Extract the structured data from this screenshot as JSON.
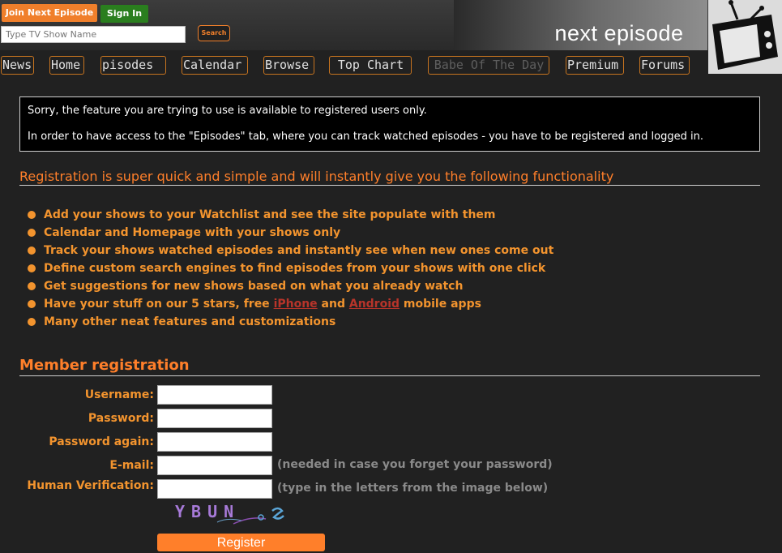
{
  "header": {
    "join_label": "Join Next Episode",
    "signin_label": "Sign In",
    "search_placeholder": "Type TV Show Name",
    "search_button": "Search",
    "brand": "next episode"
  },
  "nav": {
    "items": [
      {
        "label": "News"
      },
      {
        "label": "Home"
      },
      {
        "label": "Episodes"
      },
      {
        "label": "Calendar"
      },
      {
        "label": "Browse"
      },
      {
        "label": "Top Chart"
      },
      {
        "label": "Babe Of The Day"
      },
      {
        "label": "Premium"
      },
      {
        "label": "Forums"
      }
    ]
  },
  "notice": {
    "line1": "Sorry, the feature you are trying to use is available to registered users only.",
    "line2": "In order to have access to the \"Episodes\" tab, where you can track watched episodes - you have to be registered and logged in."
  },
  "intro": "Registration is super quick and simple and will instantly give you the following functionality",
  "features": [
    "Add your shows to your Watchlist and see the site populate with them",
    "Calendar and Homepage with your shows only",
    "Track your shows watched episodes and instantly see when new ones come out",
    "Define custom search engines to find episodes from your shows with one click",
    "Get suggestions for new shows based on what you already watch"
  ],
  "feature_mobile": {
    "before": "Have your stuff on our 5 stars, free",
    "iphone": "iPhone",
    "and": "and",
    "android": "Android",
    "after": "mobile apps"
  },
  "feature_last": "Many other neat features and customizations",
  "registration": {
    "title": "Member registration",
    "username_label": "Username:",
    "password_label": "Password:",
    "password_again_label": "Password again:",
    "email_label": "E-mail:",
    "email_hint": "(needed in case you forget your password)",
    "human_label": "Human Verification:",
    "human_hint": "(type in the letters from the image below)",
    "captcha_text": "YBUN",
    "register_label": "Register"
  },
  "colors": {
    "accent": "#ff7f2a",
    "feature_text": "#f3942e",
    "link": "#b8342a",
    "signin": "#2a7e1e",
    "background": "#212121"
  }
}
